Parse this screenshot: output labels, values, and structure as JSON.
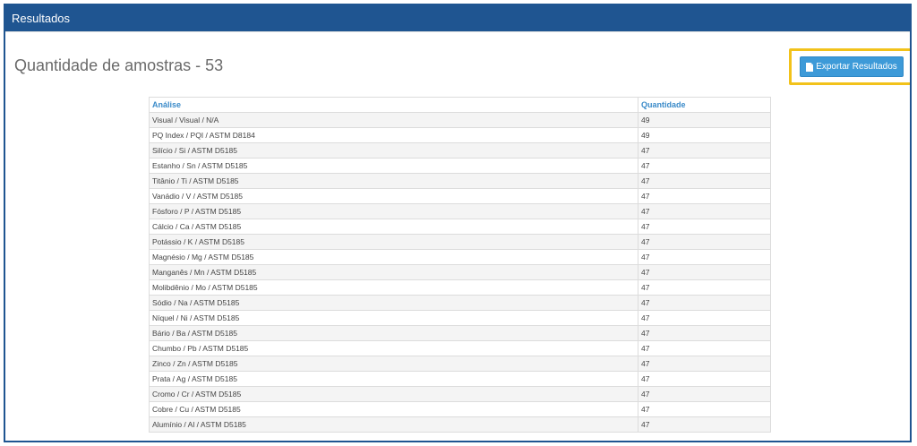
{
  "panel": {
    "title": "Resultados"
  },
  "summary": {
    "title": "Quantidade de amostras - 53"
  },
  "toolbar": {
    "export_label": "Exportar Resultados",
    "export_icon": "document-icon",
    "highlight_color": "#f2c21a",
    "button_color": "#3d9ad8"
  },
  "table": {
    "headers": [
      "Análise",
      "Quantidade"
    ],
    "rows": [
      {
        "analysis": "Visual / Visual / N/A",
        "quantity": "49"
      },
      {
        "analysis": "PQ Index / PQI / ASTM D8184",
        "quantity": "49"
      },
      {
        "analysis": "Silício / Si / ASTM D5185",
        "quantity": "47"
      },
      {
        "analysis": "Estanho / Sn / ASTM D5185",
        "quantity": "47"
      },
      {
        "analysis": "Titânio / Ti / ASTM D5185",
        "quantity": "47"
      },
      {
        "analysis": "Vanádio / V / ASTM D5185",
        "quantity": "47"
      },
      {
        "analysis": "Fósforo / P / ASTM D5185",
        "quantity": "47"
      },
      {
        "analysis": "Cálcio / Ca / ASTM D5185",
        "quantity": "47"
      },
      {
        "analysis": "Potássio / K / ASTM D5185",
        "quantity": "47"
      },
      {
        "analysis": "Magnésio / Mg / ASTM D5185",
        "quantity": "47"
      },
      {
        "analysis": "Manganês / Mn / ASTM D5185",
        "quantity": "47"
      },
      {
        "analysis": "Molibdênio / Mo / ASTM D5185",
        "quantity": "47"
      },
      {
        "analysis": "Sódio / Na / ASTM D5185",
        "quantity": "47"
      },
      {
        "analysis": "Níquel / Ni / ASTM D5185",
        "quantity": "47"
      },
      {
        "analysis": "Bário / Ba / ASTM D5185",
        "quantity": "47"
      },
      {
        "analysis": "Chumbo / Pb / ASTM D5185",
        "quantity": "47"
      },
      {
        "analysis": "Zinco / Zn / ASTM D5185",
        "quantity": "47"
      },
      {
        "analysis": "Prata / Ag / ASTM D5185",
        "quantity": "47"
      },
      {
        "analysis": "Cromo / Cr / ASTM D5185",
        "quantity": "47"
      },
      {
        "analysis": "Cobre / Cu / ASTM D5185",
        "quantity": "47"
      },
      {
        "analysis": "Alumínio / Al / ASTM D5185",
        "quantity": "47"
      }
    ]
  }
}
